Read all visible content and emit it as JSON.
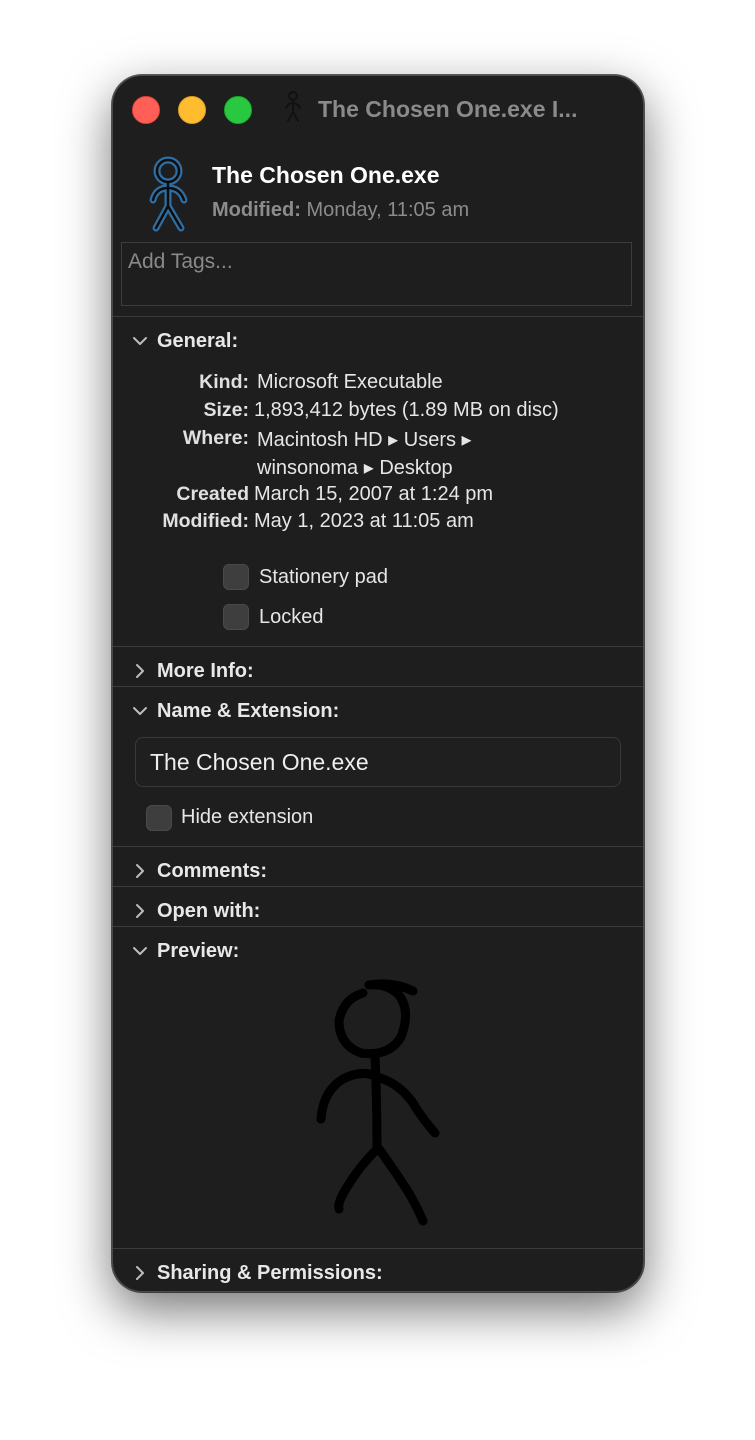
{
  "window": {
    "title": "The Chosen One.exe I..."
  },
  "header": {
    "file_name": "The Chosen One.exe",
    "modified_label": "Modified:",
    "modified_value": "Monday, 11:05 am"
  },
  "tags": {
    "placeholder": "Add Tags..."
  },
  "general": {
    "heading": "General:",
    "kind_label": "Kind:",
    "kind_value": "Microsoft Executable",
    "size_label": "Size:",
    "size_value": "1,893,412 bytes (1.89 MB on disc)",
    "where_label": "Where:",
    "where_line1": "Macintosh HD ▸ Users ▸",
    "where_line2": "winsonoma ▸ Desktop",
    "created_label": "Created",
    "created_value": "March 15, 2007 at 1:24 pm",
    "modified_label": "Modified:",
    "modified_value": "May 1, 2023 at 11:05 am",
    "stationery_label": "Stationery pad",
    "locked_label": "Locked"
  },
  "more_info": {
    "heading": "More Info:"
  },
  "name_extension": {
    "heading": "Name & Extension:",
    "name_value": "The Chosen One.exe",
    "hide_extension_label": "Hide extension"
  },
  "comments": {
    "heading": "Comments:"
  },
  "open_with": {
    "heading": "Open with:"
  },
  "preview": {
    "heading": "Preview:"
  },
  "sharing": {
    "heading": "Sharing & Permissions:"
  },
  "colors": {
    "window_bg": "#1e1e1e",
    "close": "#ff5f57",
    "minimize": "#febc2e",
    "zoom": "#28c840",
    "icon_blue": "#2f6ea3"
  }
}
